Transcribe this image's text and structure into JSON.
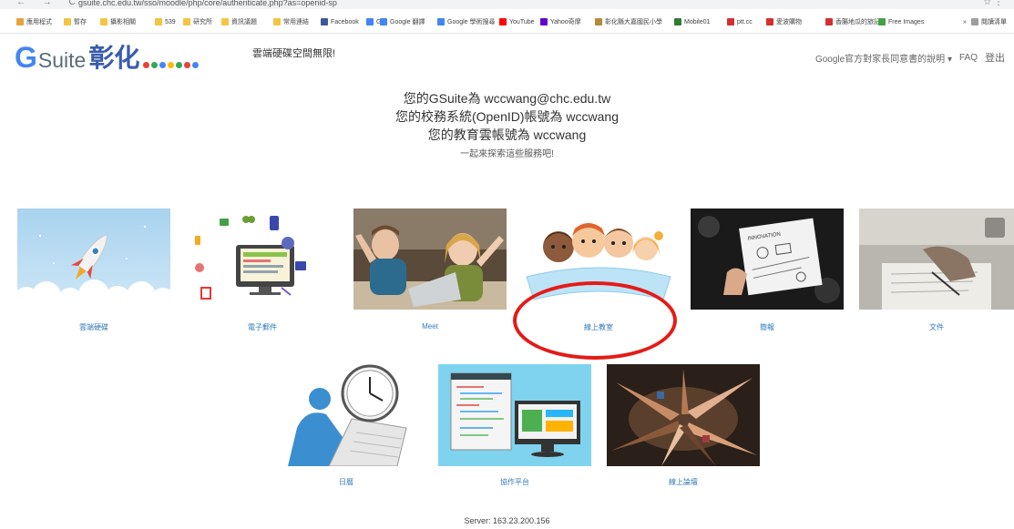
{
  "browser": {
    "nav": "← → C",
    "url": "gsuite.chc.edu.tw/sso/moodle/php/core/authenticate.php?as=openid-sp",
    "right_icons": "☆ ⋮",
    "bookmarks": [
      {
        "label": "應用程式",
        "color": "#e8a33d"
      },
      {
        "label": "暫存",
        "color": "#f4c542"
      },
      {
        "label": "攝影相關",
        "color": "#f4c542"
      },
      {
        "label": "539",
        "color": "#f4c542"
      },
      {
        "label": "研究所",
        "color": "#f4c542"
      },
      {
        "label": "資訊議題",
        "color": "#f4c542"
      },
      {
        "label": "常用連結",
        "color": "#f4c542"
      },
      {
        "label": "Facebook",
        "color": "#3b5998"
      },
      {
        "label": "G",
        "color": "#4285f4"
      },
      {
        "label": "Google 翻譯",
        "color": "#4285f4"
      },
      {
        "label": "Google 學術搜尋",
        "color": "#4285f4"
      },
      {
        "label": "YouTube",
        "color": "#ff0000"
      },
      {
        "label": "Yahoo奇摩",
        "color": "#6001d2"
      },
      {
        "label": "彰化縣大嘉國民小學",
        "color": "#b58b3a"
      },
      {
        "label": "Mobile01",
        "color": "#2e7d32"
      },
      {
        "label": "ptt.cc",
        "color": "#d32f2f"
      },
      {
        "label": "愛波購物",
        "color": "#d32f2f"
      },
      {
        "label": "香腸地瓜的旅記",
        "color": "#d32f2f"
      },
      {
        "label": "Free Images",
        "color": "#43a047"
      },
      {
        "label": "»",
        "color": "#ffffff"
      },
      {
        "label": "閱讀清單",
        "color": "#9e9e9e"
      }
    ]
  },
  "header": {
    "brand_g": "G",
    "brand_suite": "Suite",
    "brand_zh": "彰化",
    "tagline": "雲端硬碟空間無限!",
    "nav": {
      "guide": "Google官方對家長同意書的說明 ▾",
      "faq": "FAQ",
      "logout": "登出"
    }
  },
  "info": {
    "line1": "您的GSuite為 wccwang@chc.edu.tw",
    "line2": "您的校務系統(OpenID)帳號為 wccwang",
    "line3": "您的教育雲帳號為 wccwang",
    "sub": "一起來探索這些服務吧!"
  },
  "services": [
    {
      "name": "drive",
      "label": "雲端硬碟"
    },
    {
      "name": "mail",
      "label": "電子郵件"
    },
    {
      "name": "meet",
      "label": "Meet"
    },
    {
      "name": "classroom",
      "label": "線上教室"
    },
    {
      "name": "keep",
      "label": "簡報"
    },
    {
      "name": "docs",
      "label": "文件"
    },
    {
      "name": "calendar",
      "label": "日曆"
    },
    {
      "name": "sites",
      "label": "協作平台"
    },
    {
      "name": "forum",
      "label": "線上論壇"
    }
  ],
  "footer": {
    "server": "Server: 163.23.200.156"
  },
  "colors": {
    "annotation": "#e41b17",
    "caption": "#337ab7",
    "brand_blue": "#3a5cae"
  }
}
